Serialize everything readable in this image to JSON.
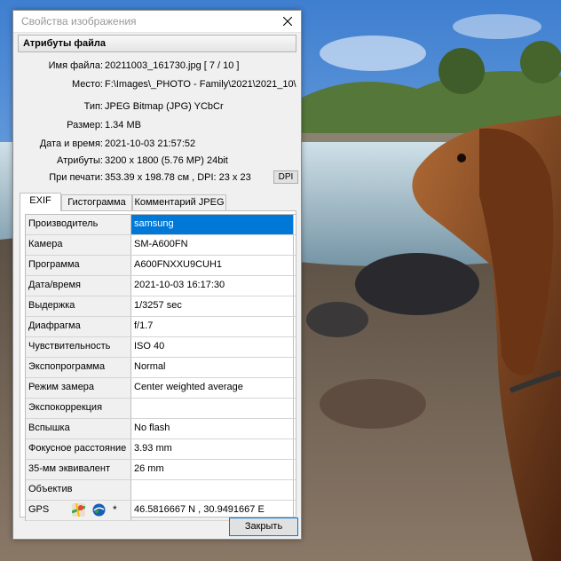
{
  "window": {
    "title": "Свойства изображения"
  },
  "file_attributes": {
    "header": "Атрибуты файла",
    "rows": [
      {
        "label": "Имя файла:",
        "value": "20211003_161730.jpg   [ 7 / 10 ]"
      },
      {
        "label": "Место:",
        "value": "F:\\Images\\_PHOTO - Family\\2021\\2021_10\\"
      },
      {
        "label": "Тип:",
        "value": "JPEG Bitmap (JPG) YCbCr"
      },
      {
        "label": "Размер:",
        "value": "1.34 MB"
      },
      {
        "label": "Дата и время:",
        "value": "2021-10-03 21:57:52"
      },
      {
        "label": "Атрибуты:",
        "value": "3200 x 1800 (5.76 MP)  24bit"
      },
      {
        "label": "При печати:",
        "value": "353.39 x 198.78 см ,  DPI: 23 x 23"
      }
    ],
    "dpi_button": "DPI"
  },
  "tabs": [
    {
      "label": "EXIF",
      "active": true
    },
    {
      "label": "Гистограмма",
      "active": false
    },
    {
      "label": "Комментарий JPEG",
      "active": false
    }
  ],
  "exif": [
    {
      "name": "Производитель",
      "value": "samsung",
      "selected": true
    },
    {
      "name": "Камера",
      "value": "SM-A600FN"
    },
    {
      "name": "Программа",
      "value": "A600FNXXU9CUH1"
    },
    {
      "name": "Дата/время",
      "value": "2021-10-03 16:17:30"
    },
    {
      "name": "Выдержка",
      "value": "1/3257 sec"
    },
    {
      "name": "Диафрагма",
      "value": "f/1.7"
    },
    {
      "name": "Чувствительность",
      "value": "ISO 40"
    },
    {
      "name": "Экспопрограмма",
      "value": "Normal"
    },
    {
      "name": "Режим замера",
      "value": "Center weighted average"
    },
    {
      "name": "Экспокоррекция",
      "value": ""
    },
    {
      "name": "Вспышка",
      "value": "No flash"
    },
    {
      "name": "Фокусное расстояние",
      "value": "3.93 mm"
    },
    {
      "name": "35-мм эквивалент",
      "value": "26 mm"
    },
    {
      "name": "Объектив",
      "value": ""
    },
    {
      "name": "GPS",
      "value": "46.5816667 N  ,  30.9491667 E",
      "icons": [
        "google-maps-icon",
        "google-earth-icon",
        "copy-star-icon"
      ],
      "star": "*"
    }
  ],
  "buttons": {
    "close": "Закрыть"
  },
  "colors": {
    "selection": "#0078d7",
    "dialog_bg": "#f0f0f0"
  }
}
